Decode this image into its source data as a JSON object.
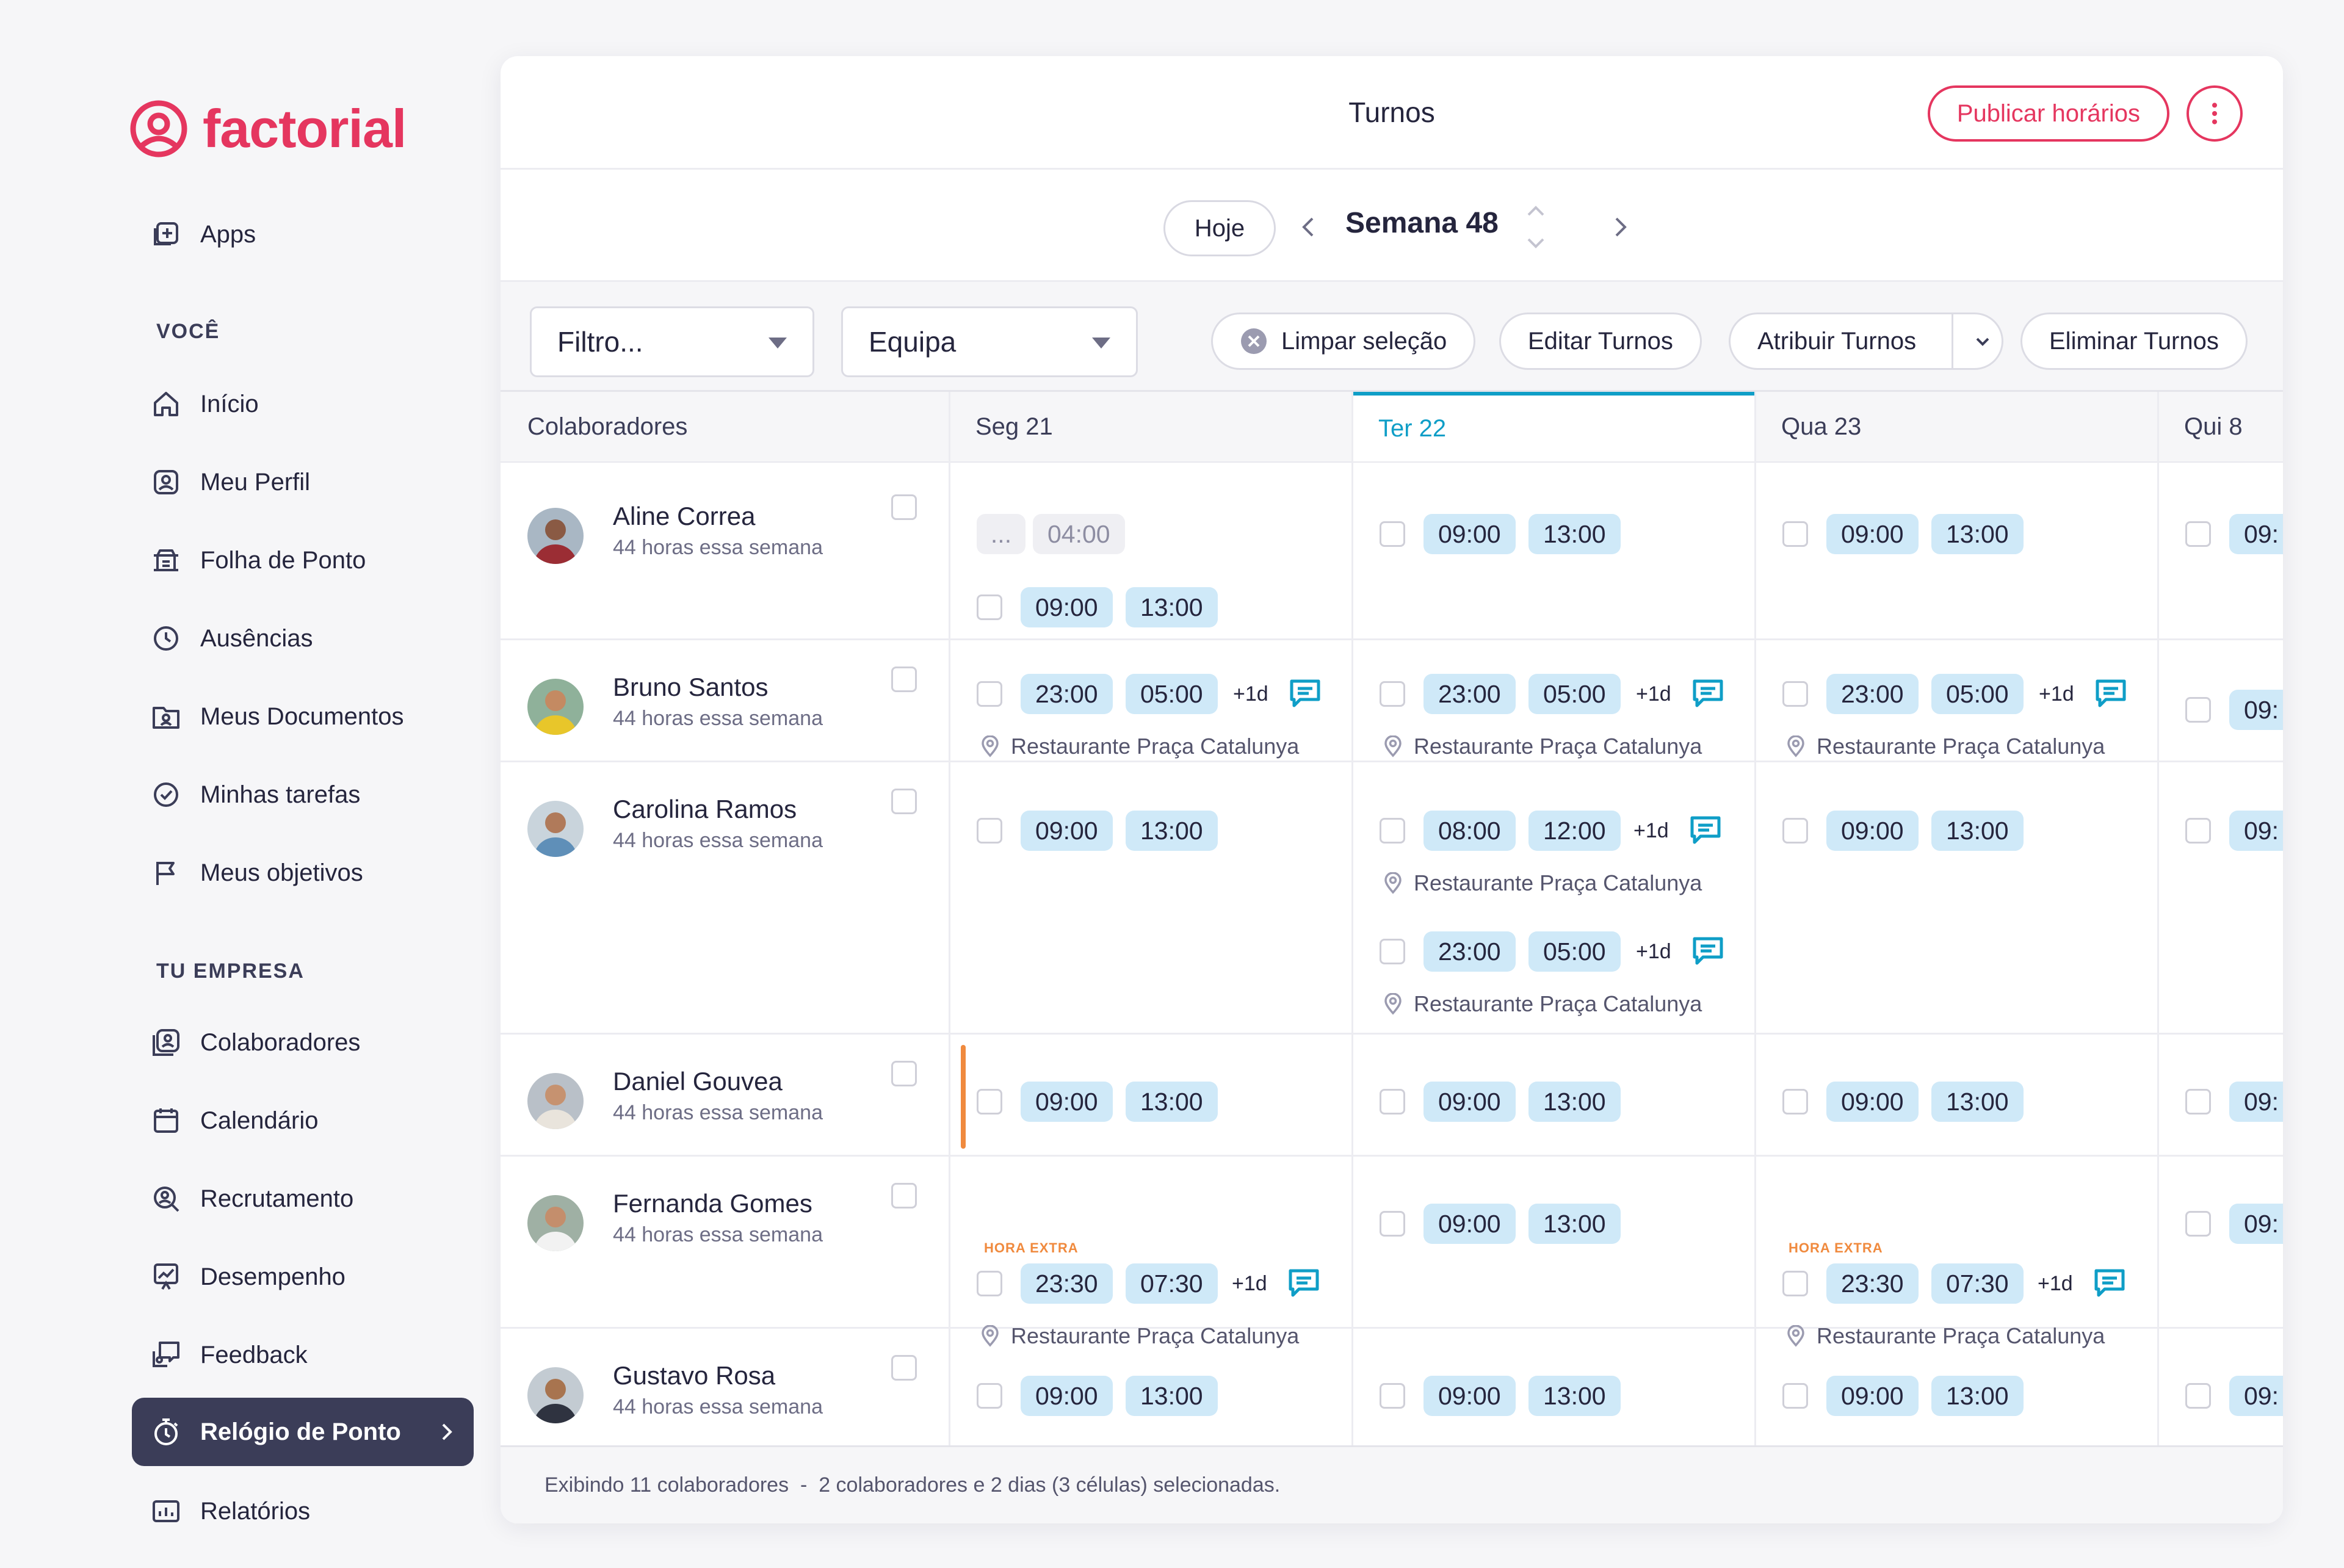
{
  "brand": {
    "name": "factorial",
    "color": "#e5365f"
  },
  "sidebar": {
    "apps": "Apps",
    "section_you": "VOCÊ",
    "you_items": [
      "Início",
      "Meu Perfil",
      "Folha de Ponto",
      "Ausências",
      "Meus Documentos",
      "Minhas tarefas",
      "Meus objetivos"
    ],
    "section_company": "TU EMPRESA",
    "company_items": [
      "Colaboradores",
      "Calendário",
      "Recrutamento",
      "Desempenho",
      "Feedback",
      "Relógio de Ponto",
      "Relatórios"
    ],
    "active_item": "Relógio de Ponto"
  },
  "header": {
    "title": "Turnos",
    "publish_label": "Publicar horários",
    "today_label": "Hoje",
    "week_label": "Semana 48"
  },
  "filters": {
    "filter_placeholder": "Filtro...",
    "team_placeholder": "Equipa",
    "clear_label": "Limpar seleção",
    "edit_label": "Editar Turnos",
    "assign_label": "Atribuir Turnos",
    "delete_label": "Eliminar Turnos"
  },
  "grid": {
    "col_people": "Colaboradores",
    "days": [
      "Seg 21",
      "Ter 22",
      "Qua 23",
      "Qui 8"
    ],
    "today_index": 1,
    "location": "Restaurante Praça Catalunya",
    "plus_day": "+1d",
    "overtime": "HORA EXTRA",
    "ellipsis": "...",
    "people": [
      {
        "name": "Aline Correa",
        "hours": "44 horas essa semana"
      },
      {
        "name": "Bruno Santos",
        "hours": "44 horas essa semana"
      },
      {
        "name": "Carolina Ramos",
        "hours": "44 horas essa semana"
      },
      {
        "name": "Daniel Gouvea",
        "hours": "44 horas essa semana"
      },
      {
        "name": "Fernanda Gomes",
        "hours": "44 horas essa semana"
      },
      {
        "name": "Gustavo Rosa",
        "hours": "44 horas essa semana"
      }
    ],
    "times": {
      "t0400": "04:00",
      "t0900": "09:00",
      "t1300": "13:00",
      "t2300": "23:00",
      "t0500": "05:00",
      "t0800": "08:00",
      "t1200": "12:00",
      "t2330": "23:30",
      "t0730": "07:30",
      "t09cut": "09:"
    }
  },
  "footer": {
    "text": "Exibindo 11 colaboradores  -  2 colaboradores e 2 dias (3 células) selecionadas."
  }
}
